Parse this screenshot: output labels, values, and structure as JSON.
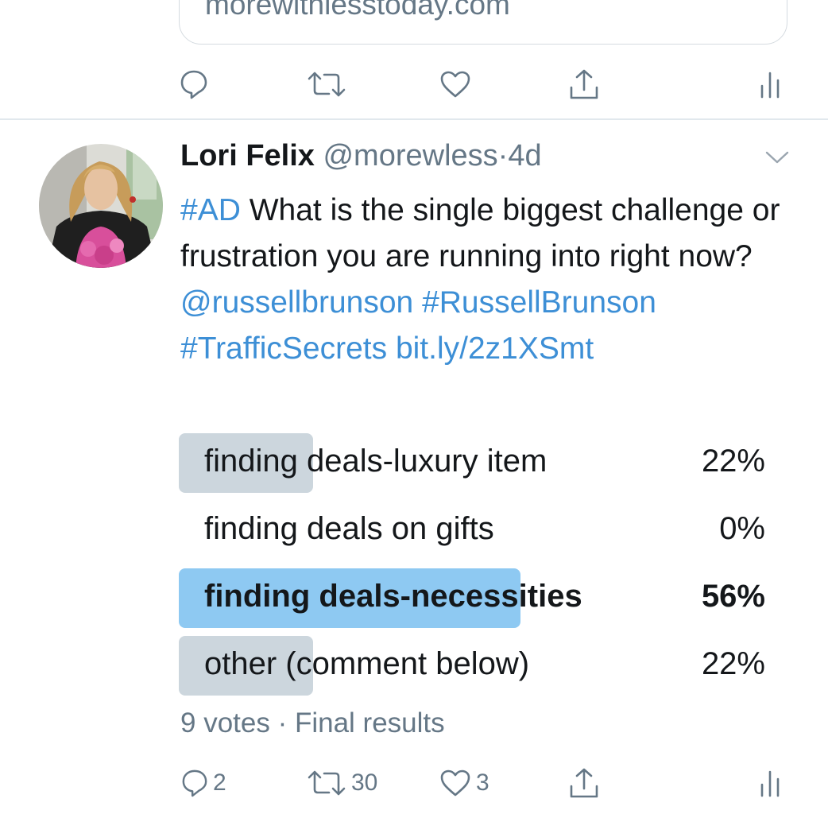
{
  "previous_tweet": {
    "card_domain": "morewithlesstoday.com"
  },
  "tweet": {
    "author_name": "Lori Felix",
    "handle": "@morewless",
    "separator": "·",
    "age": "4d",
    "hashtag_ad": "#AD",
    "body": " What is the single biggest challenge or frustration you are running into right now?",
    "mention": "@russellbrunson",
    "hashtag_russell": "#RussellBrunson",
    "hashtag_traffic": "#TrafficSecrets",
    "link": "bit.ly/2z1XSmt",
    "poll": {
      "options": [
        {
          "label": "finding deals-luxury item",
          "percent_text": "22%",
          "percent": 22,
          "winner": false
        },
        {
          "label": "finding deals on gifts",
          "percent_text": "0%",
          "percent": 0,
          "winner": false
        },
        {
          "label": "finding deals-necessities",
          "percent_text": "56%",
          "percent": 56,
          "winner": true
        },
        {
          "label": "other (comment below)",
          "percent_text": "22%",
          "percent": 22,
          "winner": false
        }
      ],
      "meta": "9 votes · Final results",
      "bar_color": "#ccd6dd",
      "winner_bar_color": "#8ec9f2"
    },
    "actions": {
      "reply_count": "2",
      "retweet_count": "30",
      "like_count": "3"
    }
  },
  "icons": {
    "reply": "reply-icon",
    "retweet": "retweet-icon",
    "like": "heart-icon",
    "share": "share-icon",
    "analytics": "analytics-icon",
    "caret": "chevron-down-icon"
  },
  "colors": {
    "link_blue": "#3d8fd6",
    "muted_gray": "#657786",
    "text": "#14171a"
  }
}
